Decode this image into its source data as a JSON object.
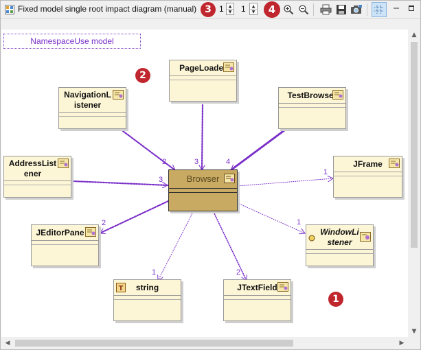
{
  "toolbar": {
    "title": "Fixed model single root impact diagram (manual)",
    "depth_value": "1",
    "width_value": "1",
    "badge_3": "3",
    "badge_4": "4",
    "icons": [
      "diagram-app-icon",
      "zoom-in-icon",
      "zoom-out-icon",
      "print-icon",
      "save-icon",
      "camera-icon",
      "grid-icon",
      "minimize-icon",
      "maximize-icon"
    ]
  },
  "diagram": {
    "namespace_label": "NamespaceUse model",
    "badge_2": "2",
    "badge_1": "1",
    "root": "Browser",
    "classes": {
      "pageloader": "PageLoader",
      "navigationlistener": "NavigationListener",
      "testbrowser": "TestBrowser",
      "addresslistener": "AddressListener",
      "jframe": "JFrame",
      "jeditorpane": "JEditorPane",
      "windowlistener": "WindowListener",
      "string": "string",
      "jtextfield": "JTextField"
    },
    "edges": [
      {
        "from": "NavigationListener",
        "to": "Browser",
        "label": "2"
      },
      {
        "from": "PageLoader",
        "to": "Browser",
        "label": "3"
      },
      {
        "from": "TestBrowser",
        "to": "Browser",
        "label": "4"
      },
      {
        "from": "AddressListener",
        "to": "Browser",
        "label": "3"
      },
      {
        "from": "Browser",
        "to": "JFrame",
        "label": "1"
      },
      {
        "from": "Browser",
        "to": "JEditorPane",
        "label": "2"
      },
      {
        "from": "Browser",
        "to": "WindowListener",
        "label": "1"
      },
      {
        "from": "Browser",
        "to": "string",
        "label": "1"
      },
      {
        "from": "Browser",
        "to": "JTextField",
        "label": "2"
      }
    ],
    "colors": {
      "edge": "#7a2fc9",
      "root_fill": "#c8aa62",
      "class_fill": "#fdf6d6",
      "badge": "#c0262d"
    }
  }
}
